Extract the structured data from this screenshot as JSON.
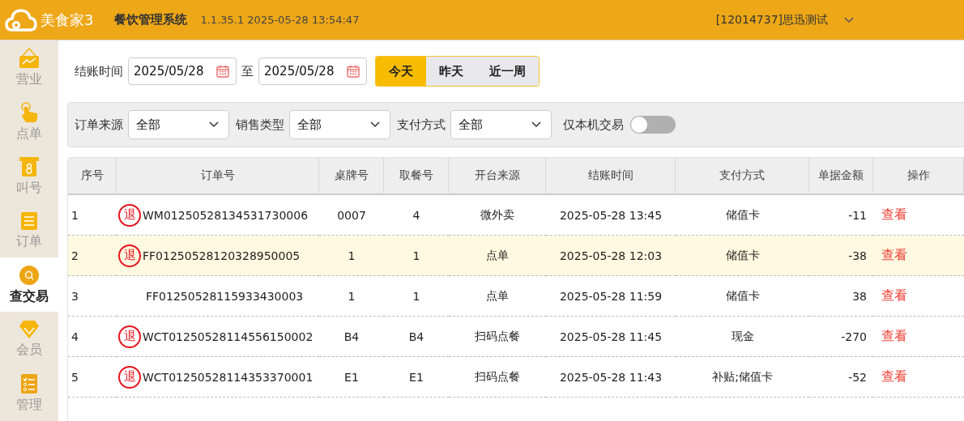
{
  "header": {
    "brand": "美食家3",
    "title": "餐饮管理系统",
    "version": "1.1.35.1 2025-05-28 13:54:47",
    "account": "[12014737]思迅测试"
  },
  "sidebar": {
    "items": [
      {
        "label": "营业",
        "kind": "sign",
        "selected": false
      },
      {
        "label": "点单",
        "kind": "hand",
        "selected": false
      },
      {
        "label": "叫号",
        "kind": "ticket",
        "selected": false
      },
      {
        "label": "订单",
        "kind": "list",
        "selected": false
      },
      {
        "label": "查交易",
        "kind": "search",
        "selected": true
      },
      {
        "label": "会员",
        "kind": "diamond",
        "selected": false
      },
      {
        "label": "管理",
        "kind": "checklist",
        "selected": false
      }
    ]
  },
  "date_filter": {
    "label": "结账时间",
    "from": "2025/05/28",
    "separator": "至",
    "to": "2025/05/28",
    "ranges": [
      {
        "label": "今天",
        "selected": true
      },
      {
        "label": "昨天",
        "selected": false
      },
      {
        "label": "近一周",
        "selected": false
      }
    ]
  },
  "filters": {
    "selects": [
      {
        "label": "订单来源",
        "value": "全部"
      },
      {
        "label": "销售类型",
        "value": "全部"
      },
      {
        "label": "支付方式",
        "value": "全部"
      }
    ],
    "toggle": {
      "label": "仅本机交易",
      "on": false
    }
  },
  "table": {
    "columns": [
      "序号",
      "订单号",
      "桌牌号",
      "取餐号",
      "开台来源",
      "结账时间",
      "支付方式",
      "单据金额",
      "操作"
    ],
    "rows": [
      {
        "no": "1",
        "refund": true,
        "refund_mark": "退",
        "order": "WM01250528134531730006",
        "table": "0007",
        "pickup": "4",
        "source": "微外卖",
        "time": "2025-05-28 13:45",
        "payment": "储值卡",
        "amount": "-11",
        "action": "查看",
        "selected": false
      },
      {
        "no": "2",
        "refund": true,
        "refund_mark": "退",
        "order": "FF01250528120328950005",
        "table": "1",
        "pickup": "1",
        "source": "点单",
        "time": "2025-05-28 12:03",
        "payment": "储值卡",
        "amount": "-38",
        "action": "查看",
        "selected": true
      },
      {
        "no": "3",
        "refund": false,
        "order": "FF01250528115933430003",
        "table": "1",
        "pickup": "1",
        "source": "点单",
        "time": "2025-05-28 11:59",
        "payment": "储值卡",
        "amount": "38",
        "action": "查看",
        "selected": false
      },
      {
        "no": "4",
        "refund": true,
        "refund_mark": "退",
        "order": "WCT01250528114556150002",
        "table": "B4",
        "pickup": "B4",
        "source": "扫码点餐",
        "time": "2025-05-28 11:45",
        "payment": "现金",
        "amount": "-270",
        "action": "查看",
        "selected": false
      },
      {
        "no": "5",
        "refund": true,
        "refund_mark": "退",
        "order": "WCT01250528114353370001",
        "table": "E1",
        "pickup": "E1",
        "source": "扫码点餐",
        "time": "2025-05-28 11:43",
        "payment": "补贴;储值卡",
        "amount": "-52",
        "action": "查看",
        "selected": false
      }
    ]
  }
}
